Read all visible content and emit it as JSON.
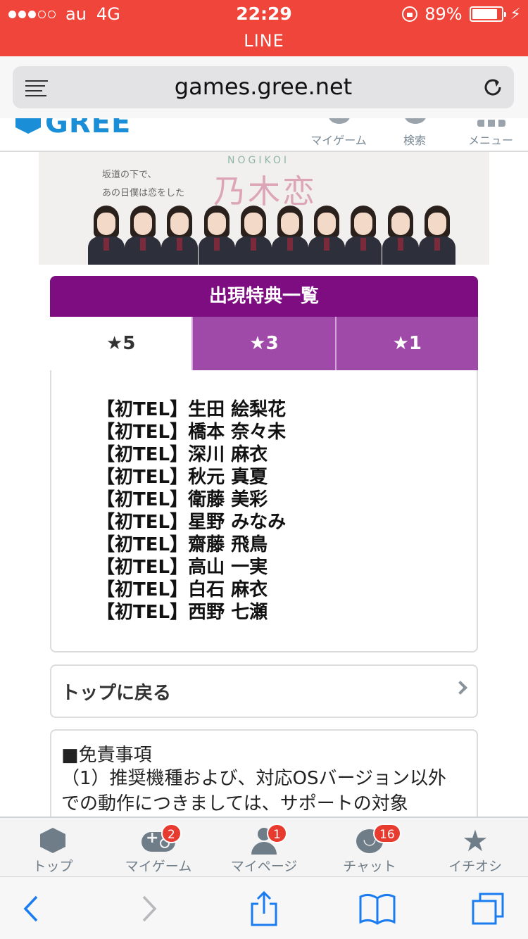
{
  "status": {
    "carrier": "au",
    "network": "4G",
    "time": "22:29",
    "battery": "89%",
    "battery_level": 0.89,
    "app_label": "LINE"
  },
  "browser": {
    "url": "games.gree.net"
  },
  "gree_header": {
    "logo": "GREE",
    "nav": [
      {
        "label": "マイゲーム",
        "icon": "controller-icon"
      },
      {
        "label": "検索",
        "icon": "search-icon"
      },
      {
        "label": "メニュー",
        "icon": "menu-icon"
      }
    ]
  },
  "banner": {
    "tagline1": "坂道の下で、",
    "tagline2": "あの日僕は恋をした",
    "title_en": "NOGIKOI",
    "title_ja": "乃木恋"
  },
  "bonus": {
    "title": "出現特典一覧",
    "tabs": [
      "★5",
      "★3",
      "★1"
    ],
    "active_tab": 0,
    "items": [
      "【初TEL】生田 絵梨花",
      "【初TEL】橋本 奈々未",
      "【初TEL】深川 麻衣",
      "【初TEL】秋元 真夏",
      "【初TEL】衛藤 美彩",
      "【初TEL】星野 みなみ",
      "【初TEL】齋藤 飛鳥",
      "【初TEL】高山 一実",
      "【初TEL】白石 麻衣",
      "【初TEL】西野 七瀬"
    ]
  },
  "back_link": {
    "label": "トップに戻る"
  },
  "disclaimer": {
    "heading": "■免責事項",
    "text": "（1）推奨機種および、対応OSバージョン以外での動作につきましては、サポートの対象"
  },
  "gree_tabbar": [
    {
      "label": "トップ",
      "icon": "gree-hex-icon",
      "badge": ""
    },
    {
      "label": "マイゲーム",
      "icon": "gamepad-icon",
      "badge": "2"
    },
    {
      "label": "マイページ",
      "icon": "person-icon",
      "badge": "1"
    },
    {
      "label": "チャット",
      "icon": "chat-icon",
      "badge": "16"
    },
    {
      "label": "イチオシ",
      "icon": "star-icon",
      "badge": ""
    }
  ],
  "colors": {
    "status_bar": "#f0453a",
    "panel_title": "#7e0d82",
    "tab_inactive": "#9f4aa8",
    "gree_blue": "#1a8ed6",
    "ios_blue": "#1a7cf0",
    "badge": "#e83b2f"
  }
}
